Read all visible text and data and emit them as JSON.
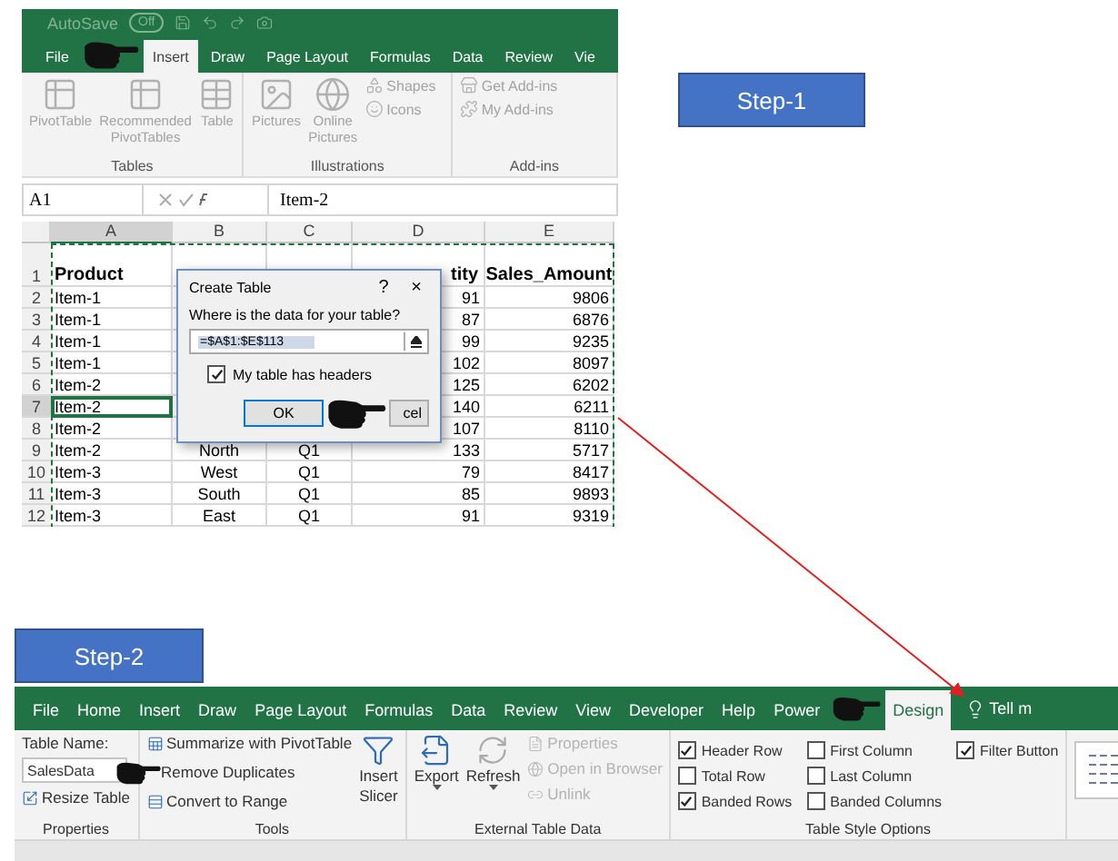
{
  "step_1_label": "Step-1",
  "step_2_label": "Step-2",
  "screenshot_1": {
    "title_bar": {
      "autosave": "AutoSave",
      "toggle": "Off"
    },
    "tabs": [
      {
        "label": "File",
        "selected": false
      },
      {
        "label": "Insert",
        "selected": true
      },
      {
        "label": "Draw",
        "selected": false
      },
      {
        "label": "Page Layout",
        "selected": false
      },
      {
        "label": "Formulas",
        "selected": false
      },
      {
        "label": "Data",
        "selected": false
      },
      {
        "label": "Review",
        "selected": false
      },
      {
        "label": "Vie",
        "selected": false
      }
    ],
    "ribbon_groups": [
      {
        "title": "Tables",
        "items": [
          {
            "label": "PivotTable",
            "kind": "large"
          },
          {
            "label": "Recommended PivotTables",
            "kind": "large"
          },
          {
            "label": "Table",
            "kind": "large"
          }
        ]
      },
      {
        "title": "Illustrations",
        "items": [
          {
            "label": "Pictures",
            "kind": "large"
          },
          {
            "label": "Online Pictures",
            "kind": "large"
          },
          {
            "label": "Shapes",
            "kind": "small"
          },
          {
            "label": "Icons",
            "kind": "small"
          }
        ]
      },
      {
        "title": "Add-ins",
        "items": [
          {
            "label": "Get Add-ins",
            "kind": "small"
          },
          {
            "label": "My Add-ins",
            "kind": "small"
          }
        ]
      }
    ],
    "name_box": "A1",
    "formula": "Item-2",
    "columns": [
      {
        "label": "A",
        "selected": true
      },
      {
        "label": "B",
        "selected": false
      },
      {
        "label": "C",
        "selected": false
      },
      {
        "label": "D",
        "selected": false
      },
      {
        "label": "E",
        "selected": false
      }
    ],
    "rows": [
      {
        "number": "1",
        "kind": "header",
        "selected": false,
        "cells": {
          "a": "Product",
          "d": "tity",
          "e": "Sales_Amount"
        }
      },
      {
        "number": "2",
        "kind": "data",
        "selected": false,
        "cells": {
          "a": "Item-1",
          "d": "91",
          "e": "9806"
        }
      },
      {
        "number": "3",
        "kind": "data",
        "selected": false,
        "cells": {
          "a": "Item-1",
          "d": "87",
          "e": "6876"
        }
      },
      {
        "number": "4",
        "kind": "data",
        "selected": false,
        "cells": {
          "a": "Item-1",
          "d": "99",
          "e": "9235"
        }
      },
      {
        "number": "5",
        "kind": "data",
        "selected": false,
        "cells": {
          "a": "Item-1",
          "d": "102",
          "e": "8097"
        }
      },
      {
        "number": "6",
        "kind": "data",
        "selected": false,
        "cells": {
          "a": "Item-2",
          "d": "125",
          "e": "6202"
        }
      },
      {
        "number": "7",
        "kind": "data",
        "selected": true,
        "cells": {
          "a": "Item-2",
          "d": "140",
          "e": "6211"
        }
      },
      {
        "number": "8",
        "kind": "data",
        "selected": false,
        "cells": {
          "a": "Item-2",
          "d": "107",
          "e": "8110"
        }
      },
      {
        "number": "9",
        "kind": "data",
        "selected": false,
        "cells": {
          "a": "Item-2",
          "b": "North",
          "c": "Q1",
          "d": "133",
          "e": "5717"
        }
      },
      {
        "number": "10",
        "kind": "data",
        "selected": false,
        "cells": {
          "a": "Item-3",
          "b": "West",
          "c": "Q1",
          "d": "79",
          "e": "8417"
        }
      },
      {
        "number": "11",
        "kind": "data",
        "selected": false,
        "cells": {
          "a": "Item-3",
          "b": "South",
          "c": "Q1",
          "d": "85",
          "e": "9893"
        }
      },
      {
        "number": "12",
        "kind": "data",
        "selected": false,
        "cells": {
          "a": "Item-3",
          "b": "East",
          "c": "Q1",
          "d": "91",
          "e": "9319"
        }
      }
    ],
    "dialog": {
      "title": "Create Table",
      "help": "?",
      "close": "×",
      "prompt": "Where is the data for your table?",
      "range": "=$A$1:$E$113",
      "checkbox": {
        "label": "My table has headers",
        "checked": true
      },
      "buttons": [
        {
          "label": "OK",
          "default": true
        },
        {
          "label": "cel",
          "default": false
        }
      ]
    }
  },
  "screenshot_2": {
    "tabs": [
      {
        "label": "File",
        "selected": false
      },
      {
        "label": "Home",
        "selected": false
      },
      {
        "label": "Insert",
        "selected": false
      },
      {
        "label": "Draw",
        "selected": false
      },
      {
        "label": "Page Layout",
        "selected": false
      },
      {
        "label": "Formulas",
        "selected": false
      },
      {
        "label": "Data",
        "selected": false
      },
      {
        "label": "Review",
        "selected": false
      },
      {
        "label": "View",
        "selected": false
      },
      {
        "label": "Developer",
        "selected": false
      },
      {
        "label": "Help",
        "selected": false
      },
      {
        "label": "Power",
        "selected": false
      },
      {
        "label": "Design",
        "selected": true
      }
    ],
    "tell_me": "Tell m",
    "properties": {
      "title": "Properties",
      "name_label": "Table Name:",
      "name_value": "SalesData",
      "resize": "Resize Table"
    },
    "tools": {
      "title": "Tools",
      "commands": [
        "Summarize with PivotTable",
        "Remove Duplicates",
        "Convert to Range"
      ],
      "slicer": "Insert Slicer"
    },
    "external": {
      "title": "External Table Data",
      "large": [
        "Export",
        "Refresh"
      ],
      "small": [
        {
          "label": "Properties",
          "disabled": true
        },
        {
          "label": "Open in Browser",
          "disabled": true
        },
        {
          "label": "Unlink",
          "disabled": true
        }
      ]
    },
    "style_options": {
      "title": "Table Style Options",
      "options": [
        {
          "label": "Header Row",
          "checked": true
        },
        {
          "label": "Total Row",
          "checked": false
        },
        {
          "label": "Banded Rows",
          "checked": true
        },
        {
          "label": "First Column",
          "checked": false
        },
        {
          "label": "Last Column",
          "checked": false
        },
        {
          "label": "Banded Columns",
          "checked": false
        },
        {
          "label": "Filter Button",
          "checked": true
        }
      ]
    }
  }
}
